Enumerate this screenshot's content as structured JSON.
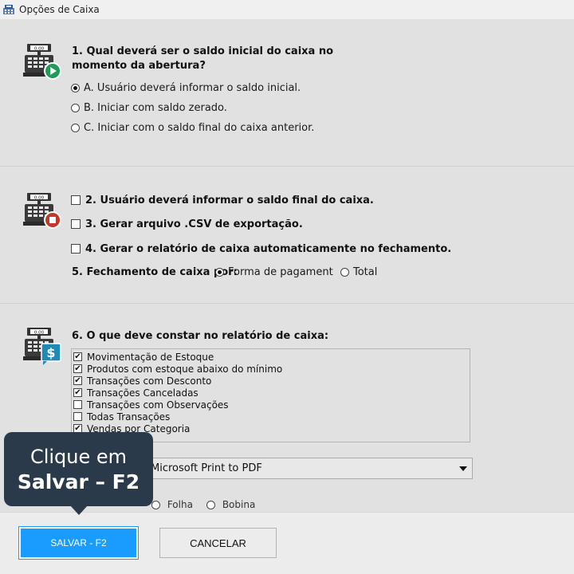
{
  "window": {
    "title": "Opções de Caixa"
  },
  "section1": {
    "question": "1. Qual deverá ser o saldo inicial do caixa no momento da abertura?",
    "options": [
      {
        "label": "A. Usuário deverá informar o saldo inicial.",
        "selected": true
      },
      {
        "label": "B. Iniciar com saldo zerado.",
        "selected": false
      },
      {
        "label": "C. Iniciar com o saldo final do caixa anterior.",
        "selected": false
      }
    ]
  },
  "section2": {
    "checks": [
      {
        "label": "2. Usuário deverá informar o saldo final do caixa.",
        "checked": false
      },
      {
        "label": "3. Gerar arquivo .CSV de exportação.",
        "checked": false
      },
      {
        "label": "4. Gerar o relatório de caixa automaticamente no fechamento.",
        "checked": false
      }
    ],
    "closing_label": "5. Fechamento de caixa por:",
    "closing_options": [
      {
        "label": "Forma de pagamento",
        "selected": true
      },
      {
        "label": "Total",
        "selected": false
      }
    ]
  },
  "section3": {
    "question": "6. O que deve constar no relatório de caixa:",
    "items": [
      {
        "label": "Movimentação de Estoque",
        "checked": true
      },
      {
        "label": "Produtos com estoque abaixo do mínimo",
        "checked": true
      },
      {
        "label": "Transações com Desconto",
        "checked": true
      },
      {
        "label": "Transações Canceladas",
        "checked": true
      },
      {
        "label": "Transações com Observações",
        "checked": false
      },
      {
        "label": "Todas Transações",
        "checked": false
      },
      {
        "label": "Vendas por Categoria",
        "checked": true
      }
    ],
    "printer_value": "Microsoft Print to PDF",
    "partial_option_a": "Folha",
    "partial_option_b": "Bobina"
  },
  "footer": {
    "save_label": "SALVAR - F2",
    "cancel_label": "CANCELAR"
  },
  "tooltip": {
    "line1": "Clique em",
    "line2": "Salvar – F2"
  },
  "icons": {
    "app": "cash-register-app-icon",
    "opening": "cash-register-play-icon",
    "closing": "cash-register-stop-icon",
    "report": "cash-register-dollar-icon"
  },
  "colors": {
    "accent": "#1a9cff",
    "play_badge": "#1f9a57",
    "stop_badge": "#c0392b",
    "report_badge": "#1f8ab5",
    "tooltip_bg": "#2a3a4a"
  }
}
